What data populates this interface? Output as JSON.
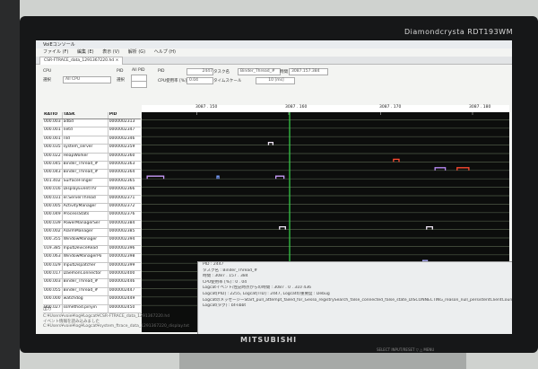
{
  "window": {
    "title": "VoiEコンソール"
  },
  "menu": [
    "ファイル (F)",
    "編集 (E)",
    "表示 (V)",
    "解析 (G)",
    "ヘルプ (H)"
  ],
  "tab": {
    "label": "CSR-FTRACE_data_1291367220.hd ×"
  },
  "controls": {
    "cpu_label": "CPU",
    "cpu_select_label": "選択",
    "cpu_value": "All CPU",
    "pid_label": "PID",
    "pid_select_label": "選択",
    "all_pid": "All PID",
    "pid_field_label": "PID",
    "pid_value": "2447",
    "task_label": "タスク名",
    "task_value": "Binder_Thread_#",
    "time_label": "時間",
    "time_value": "3087.157.384",
    "cpu_usage_label": "CPU使用率 [%]",
    "cpu_usage_value": "0.04",
    "timescale_label": "タイムスケール",
    "timescale_value": "10 [ms]"
  },
  "table": {
    "headers": [
      "RATIO",
      "TASK",
      "PID"
    ],
    "rows": [
      [
        "000.003",
        "adbd",
        "0000002313"
      ],
      [
        "000.001",
        "netd",
        "0000002347"
      ],
      [
        "000.001",
        "rild",
        "0000002346"
      ],
      [
        "000.035",
        "system_server",
        "0000002359"
      ],
      [
        "000.022",
        "HeapWorker",
        "0000002360"
      ],
      [
        "000.045",
        "Binder_Thread_#",
        "0000002363"
      ],
      [
        "000.043",
        "Binder_Thread_#",
        "0000002364"
      ],
      [
        "001.402",
        "SurfaceFlinger",
        "0000002365"
      ],
      [
        "000.016",
        "DisplayEventThr",
        "0000002366"
      ],
      [
        "000.031",
        "er.ServerThread",
        "0000002371"
      ],
      [
        "000.005",
        "ActivityManager",
        "0000002372"
      ],
      [
        "000.049",
        "ProcessStats",
        "0000002376"
      ],
      [
        "000.039",
        "PowerManagerSer",
        "0000002384"
      ],
      [
        "000.002",
        "AlarmManager",
        "0000002385"
      ],
      [
        "000.355",
        "WindowManager",
        "0000002394"
      ],
      [
        "019.385",
        "InputDeviceRead",
        "0000002396"
      ],
      [
        "000.063",
        "WindowManagerPo",
        "0000002398"
      ],
      [
        "000.029",
        "InputDispatcher",
        "0000002399"
      ],
      [
        "000.017",
        "DaemonConnector",
        "0000002400"
      ],
      [
        "000.003",
        "Binder_Thread_#",
        "0000002446"
      ],
      [
        "000.055",
        "Binder_Thread_#",
        "0000002447"
      ],
      [
        "000.000",
        "watchdog",
        "0000002449"
      ],
      [
        "000.027",
        "ssmethod.pinyin",
        "0000002450"
      ]
    ]
  },
  "timeline": {
    "ticks": [
      "3087 . 150",
      "3087 . 160",
      "3087 . 170",
      "3087 . 180"
    ],
    "cursor_color": "#39d24a",
    "line_color": "#4f5a47",
    "marks": [
      {
        "row": 3,
        "t": 0.345,
        "w": 0.012,
        "color": "#f0e6f5"
      },
      {
        "row": 5,
        "t": 0.685,
        "w": 0.015,
        "color": "#ff4a30"
      },
      {
        "row": 6,
        "t": 0.858,
        "w": 0.032,
        "color": "#ff4a30"
      },
      {
        "row": 6,
        "t": 0.798,
        "w": 0.028,
        "color": "#b98af5"
      },
      {
        "row": 7,
        "t": 0.015,
        "w": 0.045,
        "color": "#c79af8"
      },
      {
        "row": 7,
        "t": 0.365,
        "w": 0.022,
        "color": "#c79af8"
      },
      {
        "row": 7,
        "t": 0.205,
        "w": 0.004,
        "color": "#7aa0ff"
      },
      {
        "row": 13,
        "t": 0.375,
        "w": 0.016,
        "color": "#f0e6f5"
      },
      {
        "row": 13,
        "t": 0.775,
        "w": 0.016,
        "color": "#f0e6f5"
      },
      {
        "row": 17,
        "t": 0.765,
        "w": 0.012,
        "color": "#b0b0ff"
      },
      {
        "row": 20,
        "t": 0.165,
        "w": 0.01,
        "color": "#6f8cff"
      },
      {
        "row": 20,
        "t": 0.38,
        "w": 0.012,
        "color": "#d0d0d0"
      }
    ]
  },
  "info": {
    "lines": [
      "PID : 2447",
      "タスク名 : Binder_Thread_#",
      "時間 : 3087 . 157 . 384",
      "CPU使用率 [%] : 0 . 04",
      "Logcatイベント/左記時点からの時間 : 3087 . 0 . 310 436",
      "Logcat[PID] : 2255, Logcat[TID] : 2447, Logcatの重要度 : Debug",
      "LogcatのメッセージーStart_pull_attempt_failed_for_Gesso_registrySearch_false_connected_false_state_DISCONNECTING_reason_null_persistentClientCount",
      "Logcat(タグ) : bt-libbt"
    ]
  },
  "bottom": {
    "label": "出力",
    "console": [
      "C:¥Users¥voie¥log¥Logcat¥CSR-FTRACE_data_1291367220.hd",
      "イベント情報を読み込みました",
      "C:¥Users¥voie¥log¥Logcat¥system_ftrace_data_1291367220_display.txt"
    ]
  },
  "monitor": {
    "brand_top": "Diamondcrysta RDT193WM",
    "brand_bottom": "MITSUBISHI",
    "buttons": "SELECT  INPUT/RESET  ▽  △  MENU"
  }
}
